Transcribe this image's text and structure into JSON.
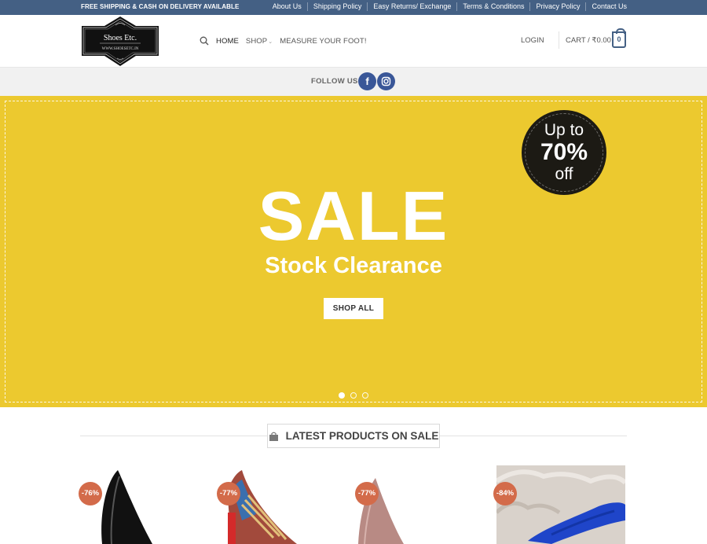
{
  "topbar": {
    "promo": "FREE SHIPPING & CASH ON DELIVERY AVAILABLE",
    "links": [
      "About Us",
      "Shipping Policy",
      "Easy Returns/ Exchange",
      "Terms & Conditions",
      "Privacy Policy",
      "Contact Us"
    ]
  },
  "header": {
    "logo_name": "Shoes Etc.",
    "logo_url_text": "WWW.SHOESETC.IN",
    "nav": [
      "HOME",
      "SHOP",
      "MEASURE YOUR FOOT!"
    ],
    "login": "LOGIN",
    "cart": "CART / ₹0.00",
    "cart_count": "0"
  },
  "follow": {
    "label": "FOLLOW US",
    "facebook": "f"
  },
  "hero": {
    "title": "SALE",
    "subtitle": "Stock Clearance",
    "button": "SHOP ALL",
    "badge": {
      "line1": "Up to",
      "line2": "70%",
      "line3": "off"
    },
    "background": "#ecc92f",
    "slides": 3,
    "active_slide": 1
  },
  "section": {
    "title": "LATEST PRODUCTS ON SALE"
  },
  "products": [
    {
      "discount": "-76%"
    },
    {
      "discount": "-77%"
    },
    {
      "discount": "-77%"
    },
    {
      "discount": "-84%"
    }
  ],
  "colors": {
    "topbar": "#446084",
    "accent": "#446084",
    "discount_badge": "#d36b4a",
    "social": "#3a5798"
  }
}
